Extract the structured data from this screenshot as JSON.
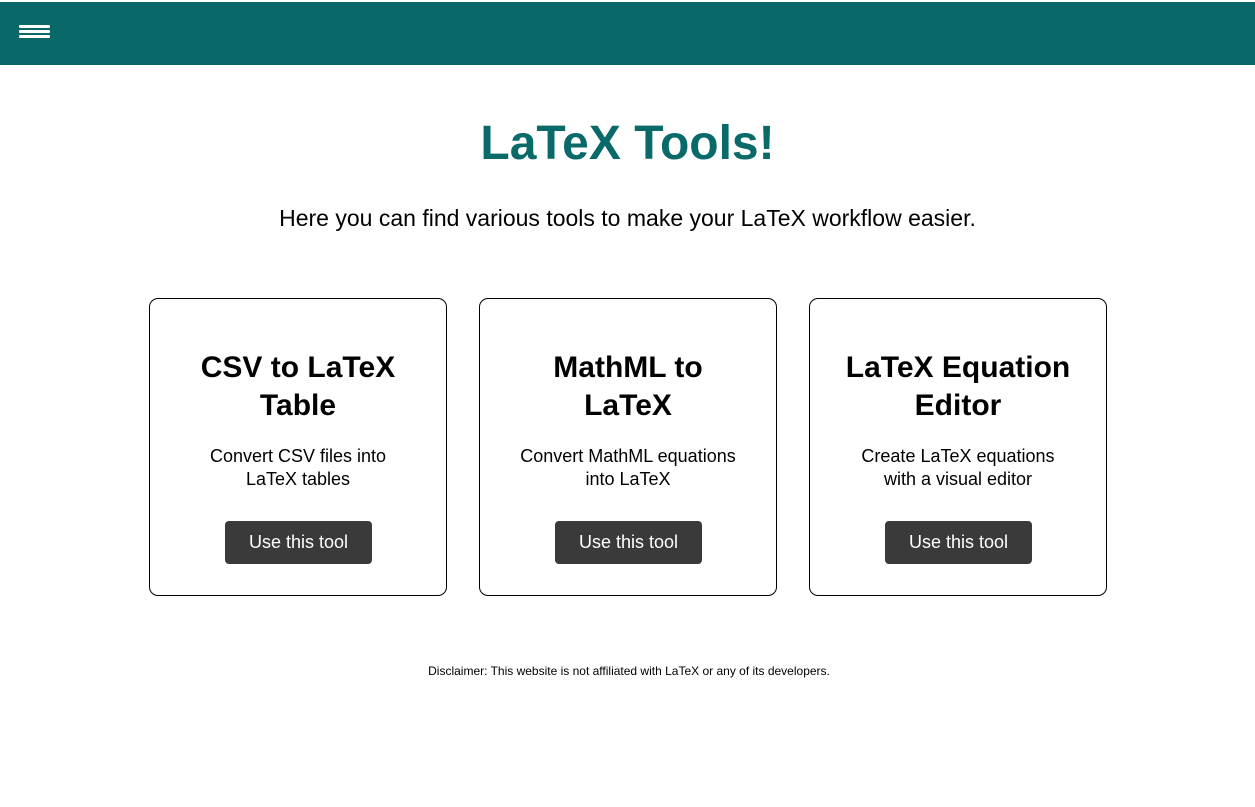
{
  "header": {
    "menu_icon": "hamburger-menu-icon",
    "background_color": "#086767"
  },
  "main": {
    "title": "LaTeX Tools!",
    "title_color": "#0a6a6a",
    "subtitle": "Here you can find various tools to make your LaTeX workflow easier."
  },
  "cards": [
    {
      "title": "CSV to LaTeX Table",
      "description": "Convert CSV files into LaTeX tables",
      "button_label": "Use this tool"
    },
    {
      "title": "MathML to LaTeX",
      "description": "Convert MathML equations into LaTeX",
      "button_label": "Use this tool"
    },
    {
      "title": "LaTeX Equation Editor",
      "description": "Create LaTeX equations with a visual editor",
      "button_label": "Use this tool"
    }
  ],
  "footer": {
    "disclaimer": "Disclaimer: This website is not affiliated with LaTeX or any of its developers."
  },
  "colors": {
    "button_background": "#3a3a3a",
    "button_text": "#ffffff"
  }
}
